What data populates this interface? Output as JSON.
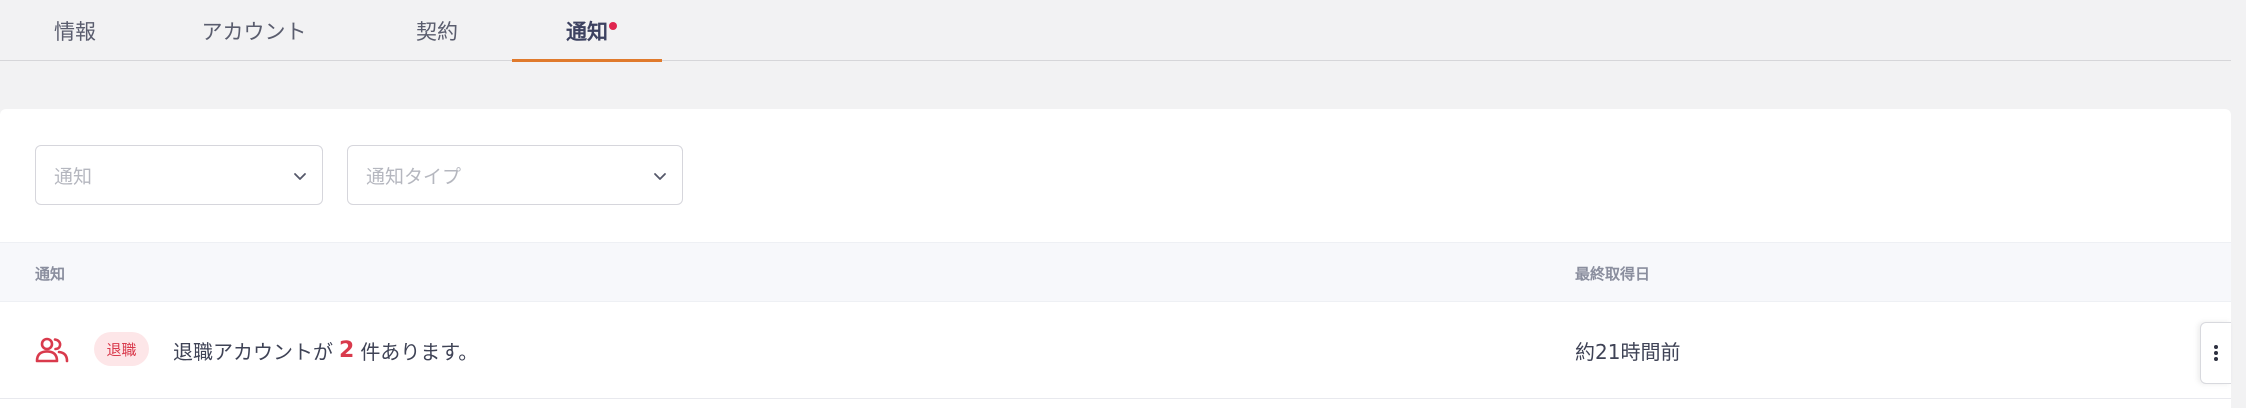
{
  "tabs": [
    {
      "label": "情報"
    },
    {
      "label": "アカウント"
    },
    {
      "label": "契約"
    },
    {
      "label": "通知",
      "active": true,
      "has_notification_dot": true
    }
  ],
  "filters": {
    "notification_placeholder": "通知",
    "notification_type_placeholder": "通知タイプ"
  },
  "table": {
    "columns": [
      "通知",
      "最終取得日"
    ],
    "rows": [
      {
        "icon": "users-icon",
        "badge": "退職",
        "message_prefix": "退職アカウントが",
        "count": "2",
        "message_suffix": "件あります。",
        "last_fetched": "約21時間前"
      }
    ]
  },
  "colors": {
    "accent": "#e07a2c",
    "danger": "#d93a4c",
    "badge_bg": "#fde6e8"
  }
}
